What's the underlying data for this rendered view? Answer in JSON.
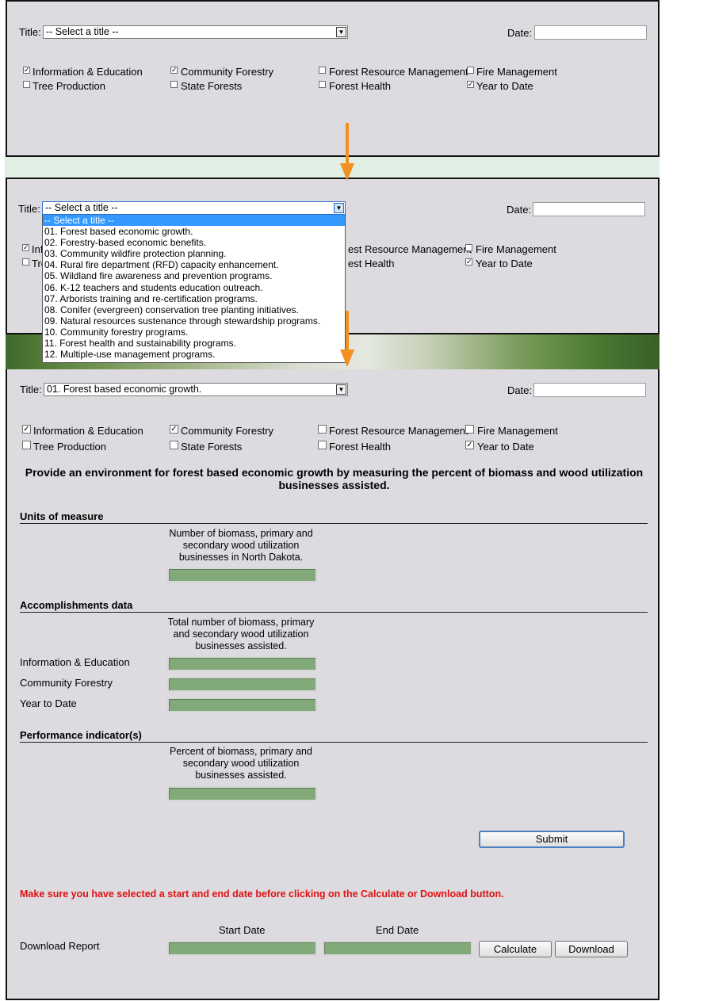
{
  "shared": {
    "title_label": "Title:",
    "date_label": "Date:",
    "checkboxes": {
      "info_ed": "Information & Education",
      "community_forestry": "Community Forestry",
      "forest_resource_mgmt": "Forest Resource Management",
      "fire_mgmt": "Fire Management",
      "tree_production": "Tree Production",
      "state_forests": "State Forests",
      "forest_health": "Forest Health",
      "year_to_date": "Year to Date"
    },
    "checked": [
      "info_ed",
      "community_forestry",
      "year_to_date"
    ]
  },
  "panel1": {
    "select_value": "-- Select a title --"
  },
  "panel2": {
    "select_value": "-- Select a title --",
    "partial_labels": {
      "info_ed": "Inf",
      "tree_production": "Tre",
      "forest_resource_mgmt": "est Resource Management",
      "forest_health": "est Health"
    },
    "dropdown_options": [
      "-- Select a title --",
      "01. Forest based economic growth.",
      "02. Forestry-based economic benefits.",
      "03. Community wildfire protection planning.",
      "04. Rural fire department (RFD) capacity enhancement.",
      "05. Wildland fire awareness and prevention programs.",
      "06. K-12 teachers and students education outreach.",
      "07. Arborists training and re-certification programs.",
      "08. Conifer (evergreen) conservation tree planting initiatives.",
      "09. Natural resources sustenance through stewardship programs.",
      "10. Community forestry programs.",
      "11. Forest health and sustainability programs.",
      "12. Multiple-use management programs."
    ],
    "highlighted_index": 0
  },
  "panel3": {
    "select_value": "01. Forest based economic growth.",
    "heading_line1": "Provide an environment for forest based economic growth by measuring the percent of biomass and wood utilization",
    "heading_line2": "businesses assisted.",
    "units": {
      "title": "Units of measure",
      "col_l1": "Number of biomass, primary and",
      "col_l2": "secondary wood utilization",
      "col_l3": "businesses in North Dakota."
    },
    "accomplishments": {
      "title": "Accomplishments data",
      "col_l1": "Total number of biomass, primary",
      "col_l2": "and secondary wood utilization",
      "col_l3": "businesses assisted.",
      "rows": [
        "Information & Education",
        "Community Forestry",
        "Year to Date"
      ]
    },
    "performance": {
      "title": "Performance indicator(s)",
      "col_l1": "Percent of biomass, primary and",
      "col_l2": "secondary wood utilization",
      "col_l3": "businesses assisted."
    },
    "submit_label": "Submit",
    "warning": "Make sure you have selected a start and end date before clicking on the Calculate or Download button.",
    "download": {
      "row_label": "Download Report",
      "start_label": "Start Date",
      "end_label": "End Date",
      "calculate_label": "Calculate",
      "download_label": "Download"
    }
  },
  "colors": {
    "arrow": "#f29021",
    "warning": "#e01010",
    "input_green": "#82a97a",
    "panel_bg": "#dddbdf"
  }
}
